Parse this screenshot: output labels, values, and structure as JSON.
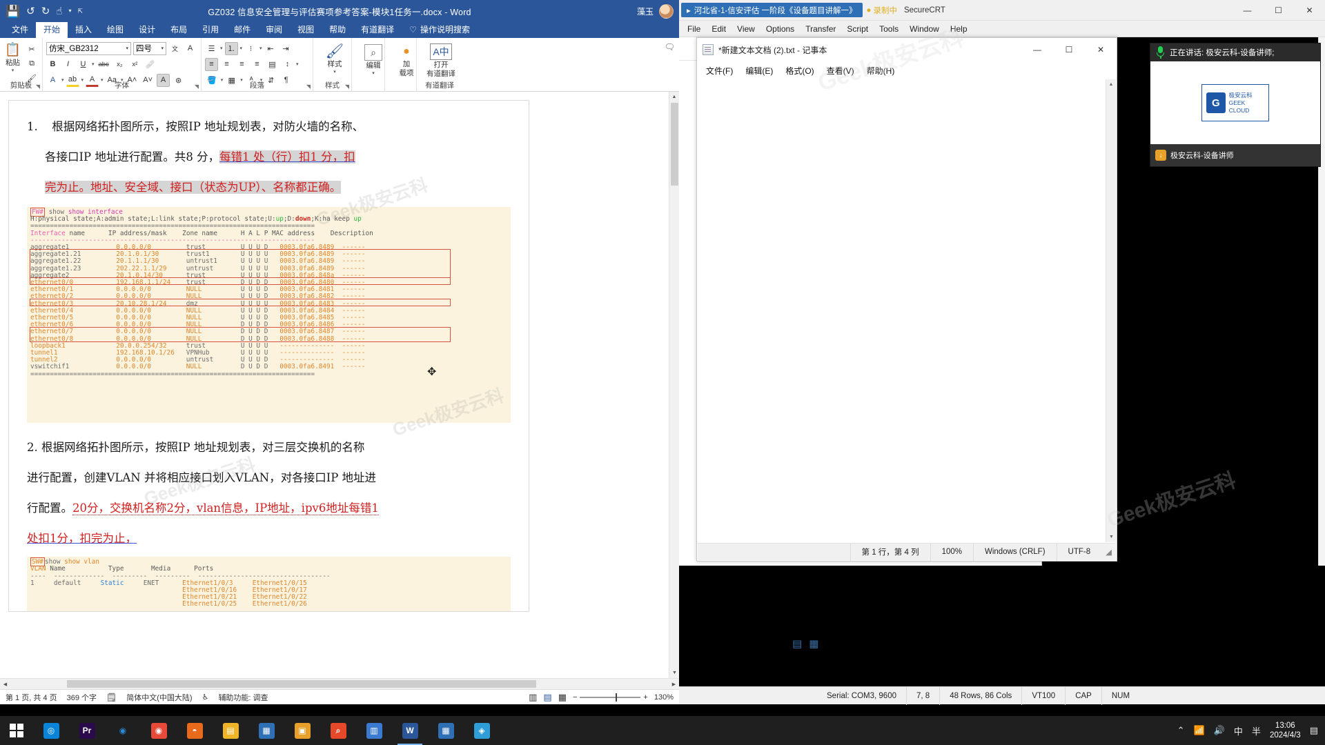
{
  "word": {
    "title": "GZ032 信息安全管理与评估赛项参考答案-模块1任务一.docx  -  Word",
    "user": "藻玉",
    "quick_access": [
      "save-icon",
      "undo-icon",
      "redo-icon",
      "touch-mode-icon",
      "customize-icon"
    ],
    "window_controls": {
      "minimize": "—",
      "maximize": "☐",
      "close": "✕"
    },
    "tabs": [
      {
        "label": "文件"
      },
      {
        "label": "开始"
      },
      {
        "label": "插入"
      },
      {
        "label": "绘图"
      },
      {
        "label": "设计"
      },
      {
        "label": "布局"
      },
      {
        "label": "引用"
      },
      {
        "label": "邮件"
      },
      {
        "label": "审阅"
      },
      {
        "label": "视图"
      },
      {
        "label": "帮助"
      },
      {
        "label": "有道翻译"
      }
    ],
    "active_tab": "开始",
    "tell_me": "操作说明搜索",
    "ribbon": {
      "clipboard": {
        "label": "剪贴板",
        "paste": "粘贴"
      },
      "font": {
        "label": "字体",
        "font_name": "仿宋_GB2312",
        "font_size": "四号",
        "bold": "B",
        "italic": "I",
        "underline": "U",
        "strike": "abc",
        "subscript": "x₂",
        "superscript": "x²",
        "clear_format": "清除格式",
        "text_effects": "A",
        "highlight": "ab",
        "font_color": "A",
        "change_case": "Aa",
        "grow": "A",
        "shrink": "A",
        "phonetic": "文",
        "enclose": "字"
      },
      "paragraph": {
        "label": "段落",
        "bullets": "项目符号",
        "numbering": "编号",
        "multilevel": "多级列表",
        "decrease_indent": "减少缩进",
        "increase_indent": "增加缩进",
        "align_left": "左对齐",
        "align_center": "居中",
        "align_right": "右对齐",
        "justify": "两端对齐",
        "distribute": "分散对齐",
        "line_spacing": "行距",
        "shading": "底纹",
        "borders": "边框",
        "sort": "排序",
        "show_marks": "显示编辑标记"
      },
      "styles": {
        "label": "样式",
        "button": "样式"
      },
      "editing": {
        "label": "",
        "button": "编辑"
      },
      "addins": {
        "label": "加载项",
        "line1": "加",
        "line2": "载项"
      },
      "youdao": {
        "label": "有道翻译",
        "line1": "打开",
        "line2": "有道翻译"
      }
    },
    "document": {
      "para1": {
        "num": "1.",
        "line1": "根据网络拓扑图所示，按照IP 地址规划表，对防火墙的名称、",
        "line2_plain": "各接口IP 地址进行配置。共8 分，",
        "line2_red": "每错1 处（行）扣1 分，扣",
        "line3_red": "完为止。地址、安全域、接口（状态为UP）、名称都正确。"
      },
      "code1": {
        "prompt": "FW#",
        "command": "show interface",
        "legend_parts": [
          "H:physical state;A:admin state;L:link state;P:protocol state;U:",
          "up",
          ";D:",
          "down",
          ";K:ha keep ",
          "up"
        ],
        "sep_eq": "=========================================================================",
        "sep_dash": "-------------------------------------------------------------------------",
        "header": {
          "c1": "Interface",
          "c1b": " name",
          "c2": "IP address/mask",
          "c3": "Zone name",
          "c4": "H A L P MAC address",
          "c5": "Description"
        },
        "rows": [
          {
            "if": "aggregate1",
            "ip": "0.0.0.0/0",
            "zone": "trust",
            "flags": "U U U D",
            "mac": "0003.0fa6.8489",
            "desc": "------"
          },
          {
            "if": "aggregate1.21",
            "ip": "20.1.0.1/30",
            "zone": "trust1",
            "flags": "U U U U",
            "mac": "0003.0fa6.8489",
            "desc": "------"
          },
          {
            "if": "aggregate1.22",
            "ip": "20.1.1.1/30",
            "zone": "untrust1",
            "flags": "U U U U",
            "mac": "0003.0fa6.8489",
            "desc": "------"
          },
          {
            "if": "aggregate1.23",
            "ip": "202.22.1.1/29",
            "zone": "untrust",
            "flags": "U U U U",
            "mac": "0003.0fa6.8489",
            "desc": "------"
          },
          {
            "if": "aggregate2",
            "ip": "20.1.0.14/30",
            "zone": "trust",
            "flags": "U U U U",
            "mac": "0003.0fa6.848a",
            "desc": "------"
          },
          {
            "if": "ethernet0/0",
            "ip": "192.168.1.1/24",
            "zone": "trust",
            "flags": "D U D D",
            "mac": "0003.0fa6.8480",
            "desc": "------"
          },
          {
            "if": "ethernet0/1",
            "ip": "0.0.0.0/0",
            "zone": "NULL",
            "flags": "U U U D",
            "mac": "0003.0fa6.8481",
            "desc": "------"
          },
          {
            "if": "ethernet0/2",
            "ip": "0.0.0.0/0",
            "zone": "NULL",
            "flags": "U U U D",
            "mac": "0003.0fa6.8482",
            "desc": "------"
          },
          {
            "if": "ethernet0/3",
            "ip": "20.10.28.1/24",
            "zone": "dmz",
            "flags": "U U U U",
            "mac": "0003.0fa6.8483",
            "desc": "------"
          },
          {
            "if": "ethernet0/4",
            "ip": "0.0.0.0/0",
            "zone": "NULL",
            "flags": "U U U D",
            "mac": "0003.0fa6.8484",
            "desc": "------"
          },
          {
            "if": "ethernet0/5",
            "ip": "0.0.0.0/0",
            "zone": "NULL",
            "flags": "U U U D",
            "mac": "0003.0fa6.8485",
            "desc": "------"
          },
          {
            "if": "ethernet0/6",
            "ip": "0.0.0.0/0",
            "zone": "NULL",
            "flags": "D U D D",
            "mac": "0003.0fa6.8486",
            "desc": "------"
          },
          {
            "if": "ethernet0/7",
            "ip": "0.0.0.0/0",
            "zone": "NULL",
            "flags": "D U D D",
            "mac": "0003.0fa6.8487",
            "desc": "------"
          },
          {
            "if": "ethernet0/8",
            "ip": "0.0.0.0/0",
            "zone": "NULL",
            "flags": "D U D D",
            "mac": "0003.0fa6.8488",
            "desc": "------"
          },
          {
            "if": "loopback1",
            "ip": "20.0.0.254/32",
            "zone": "trust",
            "flags": "U U U U",
            "mac": "--------------",
            "desc": "------"
          },
          {
            "if": "tunnel1",
            "ip": "192.168.10.1/26",
            "zone": "VPNHub",
            "flags": "U U U U",
            "mac": "--------------",
            "desc": "------"
          },
          {
            "if": "tunnel2",
            "ip": "0.0.0.0/0",
            "zone": "untrust",
            "flags": "U U U D",
            "mac": "--------------",
            "desc": "------"
          },
          {
            "if": "vswitchif1",
            "ip": "0.0.0.0/0",
            "zone": "NULL",
            "flags": "D U D D",
            "mac": "0003.0fa6.8491",
            "desc": "------"
          }
        ]
      },
      "para2": {
        "line1": "2. 根据网络拓扑图所示，按照IP  地址规划表，对三层交换机的名称",
        "line2": "进行配置，创建VLAN  并将相应接口划入VLAN，对各接口IP  地址进",
        "line3_plain": "行配置。",
        "line3_red": "20分，交换机名称2分，vlan信息，IP地址，ipv6地址每错1",
        "line4_red": "处扣1分，扣完为止，"
      },
      "code2": {
        "prompt": "SW#",
        "command": "show vlan",
        "header": {
          "c1": "VLAN",
          "c2": "Name",
          "c3": "Type",
          "c4": "Media",
          "c5": "Ports"
        },
        "sep": "----  -------------  ---------  ---------  ----------------------------------",
        "row": {
          "vlan": "1",
          "name": "default",
          "type": "Static",
          "media": "ENET"
        },
        "ports": [
          [
            "Ethernet1/0/3",
            "Ethernet1/0/15"
          ],
          [
            "Ethernet1/0/16",
            "Ethernet1/0/17"
          ],
          [
            "Ethernet1/0/21",
            "Ethernet1/0/22"
          ],
          [
            "Ethernet1/0/25",
            "Ethernet1/0/26"
          ]
        ]
      }
    },
    "status_bar": {
      "page": "第 1 页, 共 4 页",
      "words": "369 个字",
      "proofing_icon": "proofing-icon",
      "language": "简体中文(中国大陆)",
      "accessibility": "辅助功能: 调查",
      "views": [
        "read-mode-icon",
        "print-layout-icon",
        "web-layout-icon"
      ],
      "zoom_out": "−",
      "zoom_in": "+",
      "zoom": "130%"
    },
    "hscroll": {
      "left": "◀",
      "right": "▶"
    }
  },
  "securecrt": {
    "tab": "河北省-1-信安评估 一阶段《设备题目讲解一》",
    "recording": "录制中",
    "app_name": "SecureCRT",
    "menu": [
      "File",
      "Edit",
      "View",
      "Options",
      "Transfer",
      "Script",
      "Tools",
      "Window",
      "Help"
    ],
    "window_controls": {
      "minimize": "—",
      "maximize": "☐",
      "close": "✕"
    },
    "status": {
      "serial": "Serial: COM3, 9600",
      "position": "7,  8",
      "size": "48 Rows, 86 Cols",
      "emulation": "VT100",
      "cap": "CAP",
      "num": "NUM"
    },
    "icons": [
      "find-icon",
      "session-icon",
      "tile-icon"
    ]
  },
  "notepad": {
    "title": "*新建文本文档 (2).txt - 记事本",
    "menu": [
      "文件(F)",
      "编辑(E)",
      "格式(O)",
      "查看(V)",
      "帮助(H)"
    ],
    "window_controls": {
      "minimize": "—",
      "maximize": "☐",
      "close": "✕"
    },
    "status": {
      "position": "第 1 行，第 4 列",
      "zoom": "100%",
      "eol": "Windows (CRLF)",
      "encoding": "UTF-8"
    }
  },
  "speaker_overlay": {
    "speaking_label": "正在讲话: 极安云科-设备讲师;",
    "presenter": "极安云科-设备讲师",
    "logo_mark": "G",
    "logo_line1": "极安云科",
    "logo_line2": "GEEK CLOUD"
  },
  "watermarks": [
    "Geek极安云科",
    "Geek极安云科",
    "Geek极安云科",
    "Geek极安云科",
    "Geek极安云科"
  ],
  "taskbar": {
    "start": "start-icon",
    "items": [
      {
        "name": "cortana-icon",
        "glyph": "◎",
        "color": "#0a84d8"
      },
      {
        "name": "premiere-icon",
        "glyph": "Pr",
        "color": "#2a0a4a"
      },
      {
        "name": "chrome-icon",
        "glyph": "◉",
        "color": "#ffffff"
      },
      {
        "name": "recorder-icon",
        "glyph": "◉",
        "color": "#e84a3a"
      },
      {
        "name": "firefox-icon",
        "glyph": "◓",
        "color": "#e86a1a"
      },
      {
        "name": "explorer-icon",
        "glyph": "▤",
        "color": "#f0b429"
      },
      {
        "name": "securecrt-icon",
        "glyph": "▦",
        "color": "#2f6fb5"
      },
      {
        "name": "vmware-icon",
        "glyph": "▣",
        "color": "#e8a02a"
      },
      {
        "name": "search-icon",
        "glyph": "⌕",
        "color": "#e8482a"
      },
      {
        "name": "tool-icon",
        "glyph": "▥",
        "color": "#3a7ad0"
      },
      {
        "name": "word-icon",
        "glyph": "W",
        "color": "#2b579a"
      },
      {
        "name": "securecrt2-icon",
        "glyph": "▦",
        "color": "#2f6fb5"
      },
      {
        "name": "meeting-icon",
        "glyph": "◈",
        "color": "#2f9ed8"
      }
    ],
    "tray": [
      "chevron-up-icon",
      "network-icon",
      "volume-icon",
      "ime-icon-zh",
      "ime-icon-half"
    ],
    "clock_time": "13:06",
    "clock_date": "2024/4/3",
    "show-desktop": "notification-icon"
  },
  "cursor": {
    "glyph": "✥"
  }
}
